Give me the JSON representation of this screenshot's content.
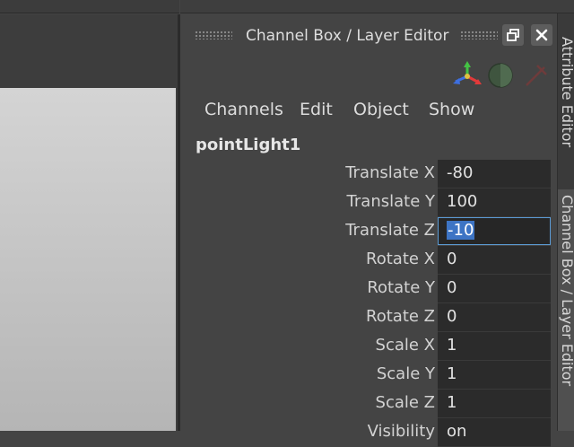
{
  "panel": {
    "title": "Channel Box / Layer Editor"
  },
  "menu": [
    "Channels",
    "Edit",
    "Object",
    "Show"
  ],
  "node_name": "pointLight1",
  "channels": [
    {
      "label": "Translate X",
      "value": "-80"
    },
    {
      "label": "Translate Y",
      "value": "100"
    },
    {
      "label": "Translate Z",
      "value": "-10",
      "active": true
    },
    {
      "label": "Rotate X",
      "value": "0"
    },
    {
      "label": "Rotate Y",
      "value": "0"
    },
    {
      "label": "Rotate Z",
      "value": "0"
    },
    {
      "label": "Scale X",
      "value": "1"
    },
    {
      "label": "Scale Y",
      "value": "1"
    },
    {
      "label": "Scale Z",
      "value": "1"
    },
    {
      "label": "Visibility",
      "value": "on"
    }
  ],
  "side_tabs": {
    "attribute_editor": "Attribute Editor",
    "channel_box": "Channel Box / Layer Editor"
  },
  "icons": {
    "float_button": "float-window-icon",
    "close_button": "close-icon",
    "manipulator": "manipulator-axes-icon",
    "shading": "shading-sphere-icon",
    "pin": "pin-icon"
  },
  "colors": {
    "panel_bg": "#444444",
    "field_bg": "#2b2b2b",
    "selection": "#3d74c4",
    "focus_border": "#5b9bd5"
  }
}
